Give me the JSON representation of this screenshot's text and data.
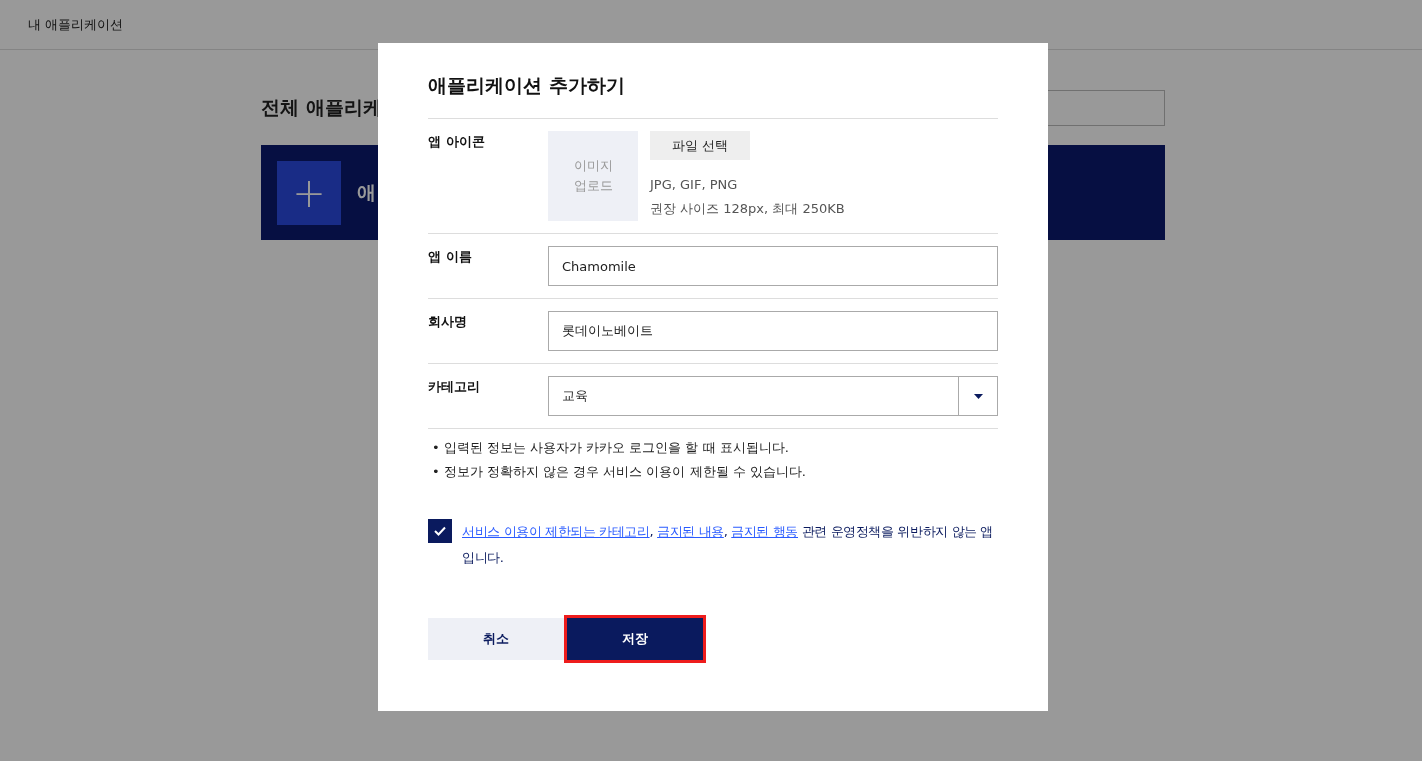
{
  "header": {
    "title": "내 애플리케이션"
  },
  "background_page": {
    "heading": "전체 애플리케",
    "add_card": {
      "icon": "+",
      "label": "애"
    }
  },
  "dialog": {
    "title": "애플리케이션 추가하기",
    "icon_row": {
      "label": "앱 아이콘",
      "upload_placeholder": "이미지\n업로드",
      "file_button": "파일 선택",
      "hints": [
        "JPG, GIF, PNG",
        "권장 사이즈 128px, 최대 250KB"
      ]
    },
    "fields": [
      {
        "kind": "text",
        "label": "앱 이름",
        "value": "Chamomile"
      },
      {
        "kind": "text",
        "label": "회사명",
        "value": "롯데이노베이트"
      },
      {
        "kind": "select",
        "label": "카테고리",
        "value": "교육"
      }
    ],
    "notes": [
      {
        "bullet": "•",
        "text": "입력된 정보는 사용자가 카카오 로그인을 할 때 표시됩니다."
      },
      {
        "bullet": "•",
        "text": "정보가 정확하지 않은 경우 서비스 이용이 제한될 수 있습니다."
      }
    ],
    "consent": {
      "checked": true,
      "parts": [
        {
          "kind": "link",
          "text": "서비스 이용이 제한되는 카테고리"
        },
        {
          "kind": "plain",
          "text": ", "
        },
        {
          "kind": "link",
          "text": "금지된 내용"
        },
        {
          "kind": "plain",
          "text": ", "
        },
        {
          "kind": "link",
          "text": "금지된 행동"
        },
        {
          "kind": "plain",
          "text": " 관련 운영정책을 위반하지 않는 앱 입니다."
        }
      ]
    },
    "buttons": [
      {
        "kind": "secondary",
        "label": "취소",
        "highlighted": false
      },
      {
        "kind": "primary",
        "label": "저장",
        "highlighted": true
      }
    ]
  }
}
